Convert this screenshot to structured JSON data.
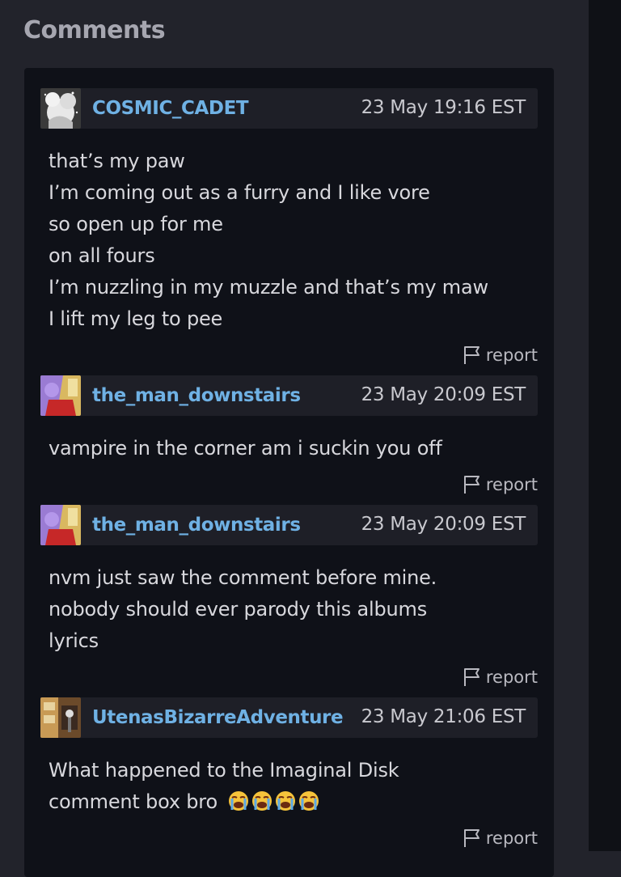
{
  "section": {
    "title": "Comments"
  },
  "comments": [
    {
      "username": "COSMIC_CADET",
      "timestamp": "23 May 19:16 EST",
      "lines": [
        "that’s my paw",
        "I’m coming out as a furry and I like vore",
        "so open up for me",
        "on all fours",
        "I’m nuzzling in my muzzle and that’s my maw",
        "I lift my leg to pee"
      ],
      "report_label": "report"
    },
    {
      "username": "the_man_downstairs",
      "timestamp": "23 May 20:09 EST",
      "lines": [
        "vampire in the corner am i suckin you off"
      ],
      "report_label": "report"
    },
    {
      "username": "the_man_downstairs",
      "timestamp": "23 May 20:09 EST",
      "lines": [
        "nvm just saw the comment before mine.",
        "nobody should ever parody this albums",
        "lyrics"
      ],
      "report_label": "report"
    },
    {
      "username": "UtenasBizarreAdventure",
      "timestamp": "23 May 21:06 EST",
      "lines": [
        "What happened to the Imaginal Disk",
        "comment box bro"
      ],
      "emoji_name": "loudly-crying-face-emoji",
      "report_label": "report"
    }
  ],
  "colors": {
    "background": "#22232b",
    "panel": "#0f1118",
    "header": "#1e1f27",
    "username": "#6fb1e4",
    "text": "#d8d8dd"
  }
}
